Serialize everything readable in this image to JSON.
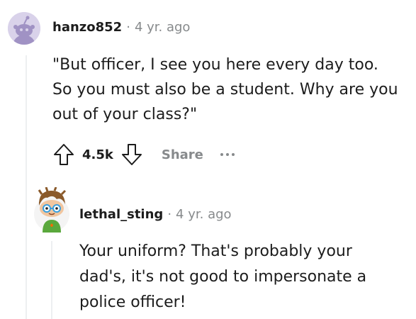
{
  "comments": [
    {
      "username": "hanzo852",
      "separator": "·",
      "timestamp": "4 yr. ago",
      "avatar_icon": "default-snoo-avatar",
      "body_lines": [
        "\"But officer, I see you here every day too.",
        "So you must also be a student. Why are you",
        "out of your class?\""
      ],
      "score": "4.5k",
      "share_label": "Share",
      "colors": {
        "avatar_bg": "#d9d2ea",
        "avatar_snoo": "#a092c4"
      }
    },
    {
      "username": "lethal_sting",
      "separator": "·",
      "timestamp": "4 yr. ago",
      "avatar_icon": "custom-snoo-avatar",
      "body_lines": [
        "Your uniform? That's probably your",
        "dad's, it's not good to impersonate a",
        "police officer!"
      ]
    }
  ]
}
